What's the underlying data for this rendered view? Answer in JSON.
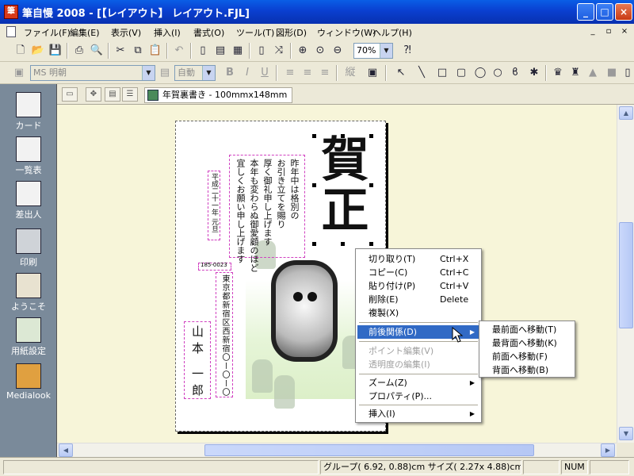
{
  "window": {
    "title": "筆自慢 2008 - [【レイアウト】 レイアウト.FJL]",
    "app_icon": "筆",
    "controls": [
      "_",
      "□",
      "×"
    ]
  },
  "menu": {
    "items": [
      "ファイル(F)",
      "編集(E)",
      "表示(V)",
      "挿入(I)",
      "書式(O)",
      "ツール(T)",
      "図形(D)",
      "ウィンドウ(W)",
      "ヘルプ(H)"
    ],
    "mdi_controls": [
      "_",
      "▫",
      "×"
    ]
  },
  "toolbar": {
    "zoom": "70%",
    "font_name": "MS 明朝",
    "font_size": "自動",
    "vertical_label": "縦"
  },
  "doc_tab": {
    "label": "年賀裏書き - 100mmx148mm"
  },
  "left_panel": {
    "items": [
      "カード",
      "一覧表",
      "差出人",
      "印刷",
      "ようこそ",
      "用紙設定",
      "Medialook"
    ]
  },
  "card": {
    "big_chars": [
      "賀",
      "正"
    ],
    "message_lines": [
      "昨年中は格別の",
      "お引き立てを賜り",
      "厚く御礼申し上げます",
      "本年も変わらぬ御愛顧のほど",
      "宜しくお願い申し上げます"
    ],
    "date": "平成二十一年 元旦",
    "postal": "185-0023",
    "address": "東京都新宿区西新宿〇ー〇ー〇",
    "name": "山本 一郎"
  },
  "context_menu": {
    "items": [
      {
        "label": "切り取り(T)",
        "shortcut": "Ctrl+X"
      },
      {
        "label": "コピー(C)",
        "shortcut": "Ctrl+C"
      },
      {
        "label": "貼り付け(P)",
        "shortcut": "Ctrl+V"
      },
      {
        "label": "削除(E)",
        "shortcut": "Delete"
      },
      {
        "label": "複製(X)",
        "shortcut": ""
      },
      {
        "label": "前後関係(D)",
        "shortcut": ""
      },
      {
        "label": "ポイント編集(V)",
        "shortcut": ""
      },
      {
        "label": "透明度の編集(I)",
        "shortcut": ""
      },
      {
        "label": "ズーム(Z)",
        "shortcut": ""
      },
      {
        "label": "プロパティ(P)...",
        "shortcut": ""
      },
      {
        "label": "挿入(I)",
        "shortcut": ""
      }
    ]
  },
  "submenu": {
    "items": [
      "最前面へ移動(T)",
      "最背面へ移動(K)",
      "前面へ移動(F)",
      "背面へ移動(B)"
    ]
  },
  "status": {
    "position": "グループ( 6.92, 0.88)cm サイズ( 2.27x 4.88)cm",
    "num": "NUM"
  }
}
